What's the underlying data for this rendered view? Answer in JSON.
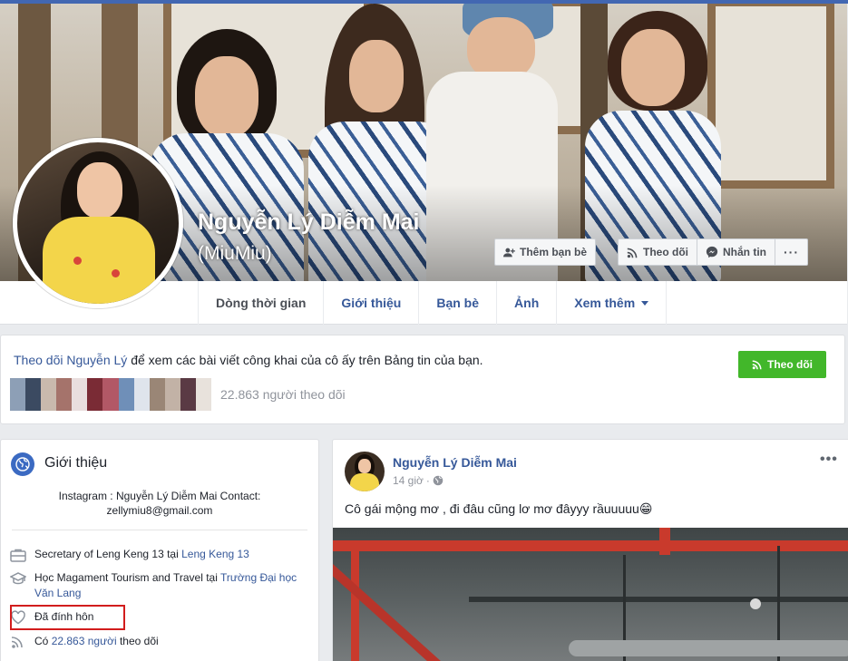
{
  "profile": {
    "name": "Nguyễn Lý Diễm Mai",
    "alternate_name": "(MiuMiu)"
  },
  "cover_actions": {
    "add_friend": "Thêm bạn bè",
    "follow": "Theo dõi",
    "message": "Nhắn tin",
    "more": "···"
  },
  "tabs": [
    {
      "label": "Dòng thời gian",
      "active": true
    },
    {
      "label": "Giới thiệu"
    },
    {
      "label": "Bạn bè"
    },
    {
      "label": "Ảnh"
    },
    {
      "label": "Xem thêm"
    }
  ],
  "follow_banner": {
    "link_text": "Theo dõi Nguyễn Lý",
    "text": " để xem các bài viết công khai của cô ấy trên Bảng tin của bạn.",
    "button": "Theo dõi",
    "followers": "22.863 người theo dõi"
  },
  "intro": {
    "title": "Giới thiệu",
    "bio": "Instagram : Nguyễn Lý Diễm Mai Contact: zellymiu8@gmail.com",
    "work_prefix": "Secretary of Leng Keng 13 tại ",
    "work_link": "Leng Keng 13",
    "education_prefix": "Học Magament Tourism and Travel tại ",
    "education_link": "Trường Đại học Văn Lang",
    "relationship": "Đã đính hôn",
    "followers_prefix": "Có ",
    "followers_link": "22.863 người",
    "followers_suffix": " theo dõi"
  },
  "post": {
    "author": "Nguyễn Lý Diễm Mai",
    "time": "14 giờ",
    "text": "Cô gái mộng mơ , đi đâu cũng lơ mơ đâyyy rầuuuuu😁",
    "menu": "•••"
  },
  "colors": {
    "fb_blue": "#4267b2",
    "link": "#365899",
    "follow_green": "#42b72a",
    "highlight_red": "#d21d1d"
  }
}
